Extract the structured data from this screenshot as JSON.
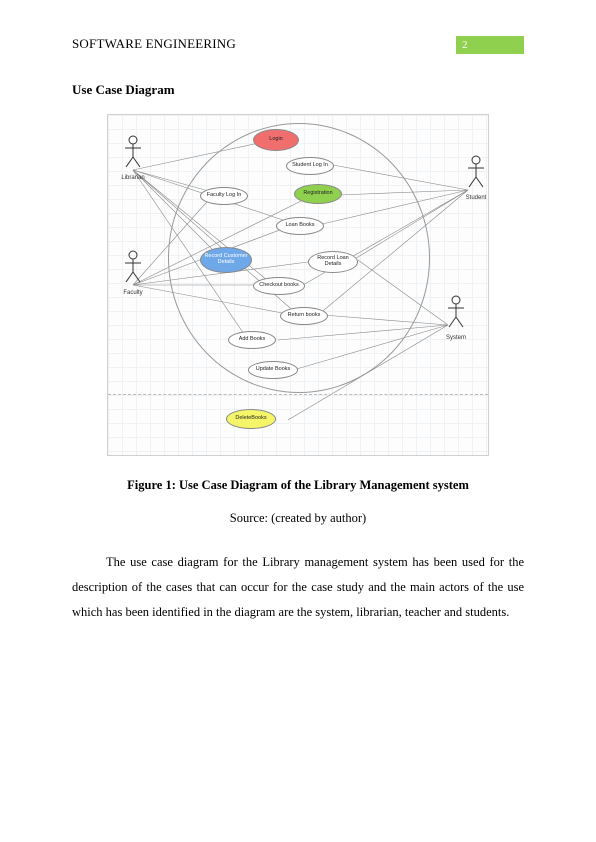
{
  "header": {
    "title": "SOFTWARE ENGINEERING",
    "page_number": "2"
  },
  "section_title": "Use Case Diagram",
  "diagram": {
    "actors": {
      "librarian": "Librarian",
      "faculty": "Faculty",
      "student": "Student",
      "system": "System"
    },
    "use_cases": {
      "login": "Login",
      "student_login": "Student Log In",
      "faculty_login": "Faculty Log In",
      "registration": "Registration",
      "loan_books": "Loan Books",
      "record_customer": "Record Customer Details",
      "record_loan": "Record Loan Details",
      "checkout_books": "Checkout books",
      "return_books": "Return books",
      "add_books": "Add Books",
      "update_books": "Update Books",
      "delete_books": "DeleteBooks"
    }
  },
  "figure": {
    "caption": "Figure 1: Use Case Diagram of the Library Management system",
    "source": "Source: (created by author)"
  },
  "chart_data": {
    "type": "table",
    "description": "UML use case diagram",
    "actors": [
      "Librarian",
      "Faculty",
      "Student",
      "System"
    ],
    "use_cases": [
      "Login",
      "Student Log In",
      "Faculty Log In",
      "Registration",
      "Loan Books",
      "Record Customer Details",
      "Record Loan Details",
      "Checkout books",
      "Return books",
      "Add Books",
      "Update Books",
      "DeleteBooks"
    ],
    "associations": [
      [
        "Librarian",
        "Login"
      ],
      [
        "Librarian",
        "Faculty Log In"
      ],
      [
        "Librarian",
        "Record Customer Details"
      ],
      [
        "Librarian",
        "Loan Books"
      ],
      [
        "Librarian",
        "Checkout books"
      ],
      [
        "Librarian",
        "Return books"
      ],
      [
        "Librarian",
        "Add Books"
      ],
      [
        "Faculty",
        "Faculty Log In"
      ],
      [
        "Faculty",
        "Registration"
      ],
      [
        "Faculty",
        "Loan Books"
      ],
      [
        "Faculty",
        "Record Loan Details"
      ],
      [
        "Faculty",
        "Checkout books"
      ],
      [
        "Faculty",
        "Return books"
      ],
      [
        "Student",
        "Student Log In"
      ],
      [
        "Student",
        "Registration"
      ],
      [
        "Student",
        "Loan Books"
      ],
      [
        "Student",
        "Record Loan Details"
      ],
      [
        "Student",
        "Checkout books"
      ],
      [
        "Student",
        "Return books"
      ],
      [
        "System",
        "Record Loan Details"
      ],
      [
        "System",
        "Return books"
      ],
      [
        "System",
        "Add Books"
      ],
      [
        "System",
        "Update Books"
      ],
      [
        "System",
        "DeleteBooks"
      ]
    ]
  },
  "paragraph": "The use case diagram for the Library management system has been used for the description of the cases that can occur for the case study and the main actors of the use which has been identified in the diagram are the system, librarian, teacher and students."
}
